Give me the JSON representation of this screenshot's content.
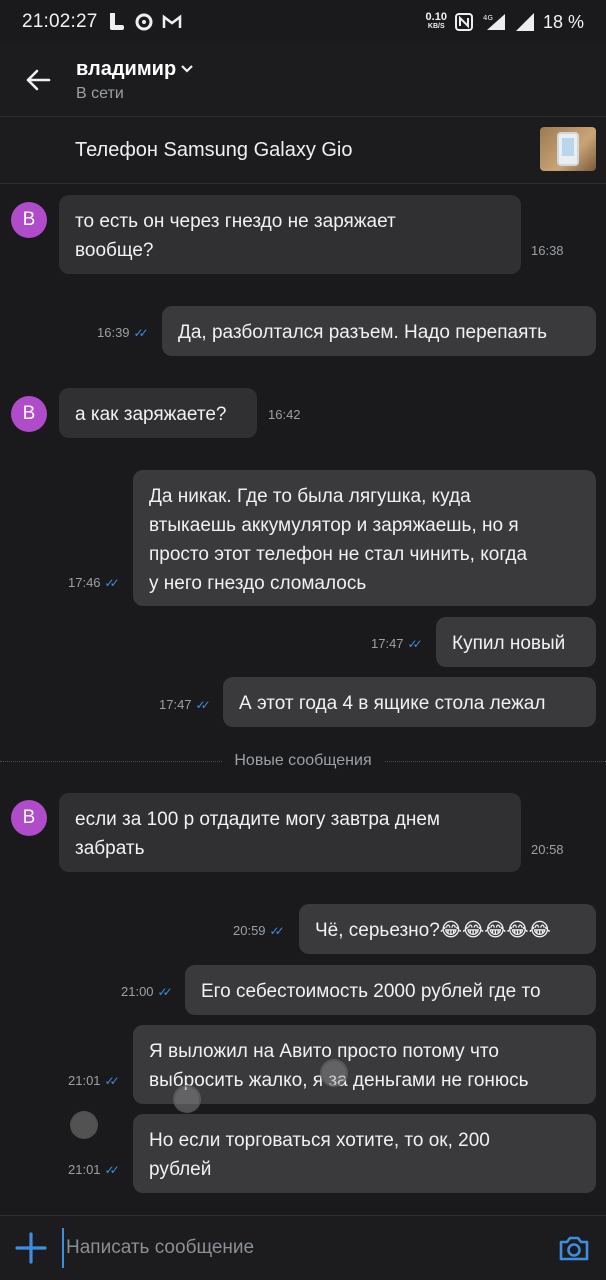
{
  "status": {
    "time": "21:02:27",
    "net_speed": "0.10",
    "net_unit": "KB/S",
    "network_type": "4G",
    "battery": "18 %"
  },
  "header": {
    "contact_name": "владимир",
    "contact_status": "В сети",
    "back_icon": "arrow-left-icon",
    "dropdown_icon": "chevron-down-icon"
  },
  "item": {
    "title": "Телефон Samsung Galaxy Gio"
  },
  "contact_initial": "В",
  "messages": [
    {
      "dir": "in",
      "text_lines": [
        "то есть он через гнездо не заряжает",
        "вообще?"
      ],
      "time": "16:38"
    },
    {
      "dir": "out",
      "text_lines": [
        "Да, разболтался разъем. Надо перепаять"
      ],
      "time": "16:39"
    },
    {
      "dir": "in",
      "text_lines": [
        "а как заряжаете?"
      ],
      "time": "16:42"
    },
    {
      "dir": "out",
      "text_lines": [
        "Да никак. Где то была лягушка, куда",
        "втыкаешь аккумулятор и заряжаешь, но я",
        "просто этот телефон не стал чинить, когда",
        "у него гнездо сломалось"
      ],
      "time": "17:46"
    },
    {
      "dir": "out",
      "text_lines": [
        "Купил новый"
      ],
      "time": "17:47"
    },
    {
      "dir": "out",
      "text_lines": [
        "А этот года 4 в ящике стола лежал"
      ],
      "time": "17:47"
    },
    {
      "dir": "in",
      "text_lines": [
        "если за 100 р отдадите могу завтра днем",
        "забрать"
      ],
      "time": "20:58"
    },
    {
      "dir": "out",
      "text_lines": [
        "Чё, серьезно?😂😂😂😂😂"
      ],
      "time": "20:59"
    },
    {
      "dir": "out",
      "text_lines": [
        "Его себестоимость 2000 рублей где то"
      ],
      "time": "21:00"
    },
    {
      "dir": "out",
      "text_lines": [
        "Я выложил на Авито просто потому что",
        "выбросить жалко, я за деньгами не гонюсь"
      ],
      "time": "21:01"
    },
    {
      "dir": "out",
      "text_lines": [
        "Но если торговаться хотите, то ок, 200",
        "рублей"
      ],
      "time": "21:01"
    }
  ],
  "new_messages_label": "Новые сообщения",
  "composer": {
    "placeholder": "Написать сообщение",
    "add_icon": "plus-icon",
    "camera_icon": "camera-icon"
  },
  "colors": {
    "background": "#1a1a1c",
    "bubble": "#3a3a3d",
    "avatar": "#b04bc9",
    "accent": "#3d8ee0"
  }
}
